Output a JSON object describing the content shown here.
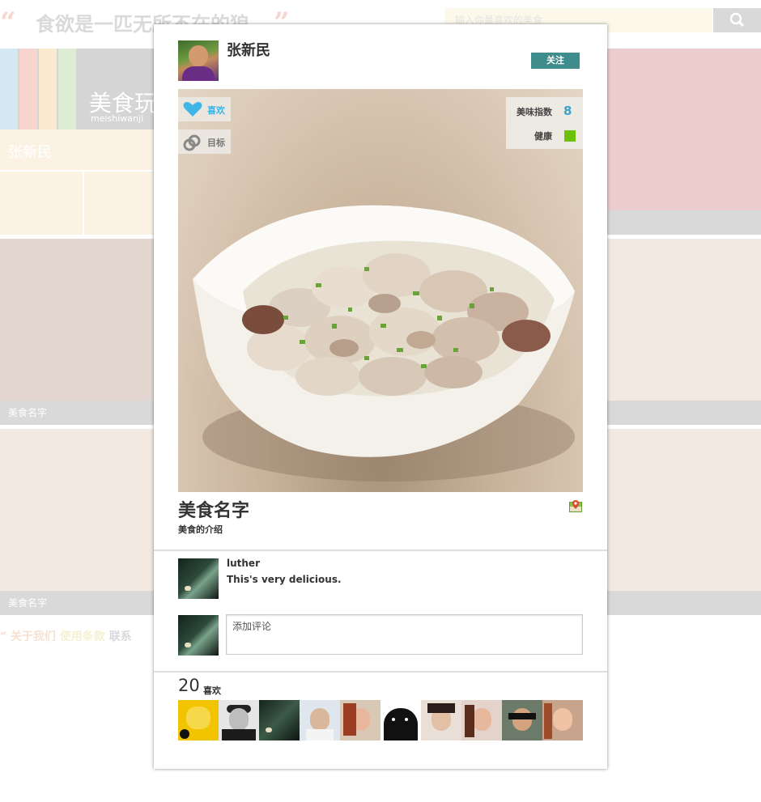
{
  "background": {
    "quote_open": "“",
    "quote_close": "”",
    "slogan": "食欲是一匹无所不在的狼",
    "search_placeholder": "输入你最喜欢的美食",
    "brand_name": "美食玩",
    "brand_sub": "meishiwanji",
    "user_name": "张新民",
    "tile_caption_1": "美食名字",
    "tile_caption_2": "美食名字",
    "footer_quote": "“",
    "footer_about": "关于我们",
    "footer_terms": "使用条款",
    "footer_contact": "联系"
  },
  "card": {
    "author_name": "张新民",
    "follow_label": "关注",
    "like_label": "喜欢",
    "target_label": "目标",
    "score_label": "美味指数",
    "score_value": "8",
    "health_label": "健康",
    "food_name": "美食名字",
    "food_intro": "美食的介绍",
    "comments": [
      {
        "author": "luther",
        "text": "This's very delicious."
      }
    ],
    "comment_placeholder": "添加评论",
    "likes_count": "20",
    "likes_label": "喜欢"
  },
  "colors": {
    "accent_teal": "#3f8c8c",
    "like_blue": "#41b6e6",
    "score_blue": "#3ba2c8",
    "health_green": "#6cc20b"
  },
  "icons": [
    "heart-icon",
    "link-icon",
    "map-pin-icon",
    "search-icon"
  ]
}
